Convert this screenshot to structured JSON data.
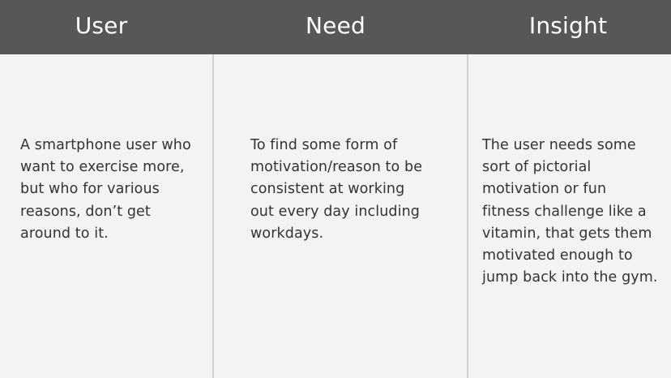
{
  "colors": {
    "header_background": "#575757",
    "header_text": "#ffffff",
    "body_background": "#f3f3f3",
    "body_text": "#333333",
    "divider": "#d2d2d2"
  },
  "columns": [
    {
      "heading": "User",
      "lines": [
        "A smartphone user who",
        "want to exercise more,",
        "but who for various",
        "reasons, don’t get",
        "around to it."
      ]
    },
    {
      "heading": "Need",
      "lines": [
        "To find some form of",
        "motivation/reason to be",
        "consistent at working",
        "out every day including",
        "workdays."
      ]
    },
    {
      "heading": "Insight",
      "lines": [
        "The user needs some",
        "sort of pictorial",
        "motivation or fun",
        "fitness challenge like a",
        "vitamin, that gets them",
        "motivated enough to",
        "jump back into the gym."
      ]
    }
  ]
}
